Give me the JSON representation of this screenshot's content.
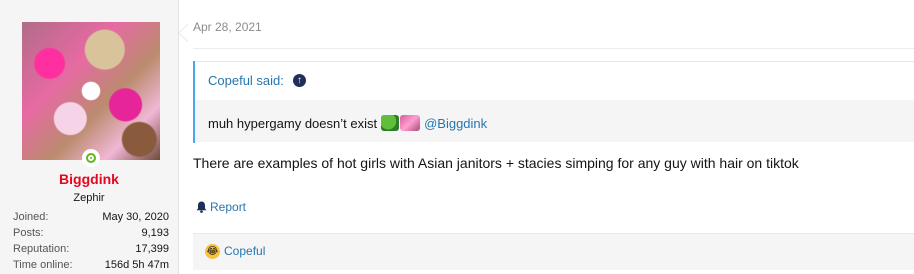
{
  "user": {
    "name": "Biggdink",
    "title": "Zephir",
    "stats": [
      {
        "label": "Joined:",
        "value": "May 30, 2020"
      },
      {
        "label": "Posts:",
        "value": "9,193"
      },
      {
        "label": "Reputation:",
        "value": "17,399"
      },
      {
        "label": "Time online:",
        "value": "156d 5h 47m"
      }
    ]
  },
  "post": {
    "date": "Apr 28, 2021",
    "quote": {
      "author_label": "Copeful said:",
      "text": "muh hypergamy doesn’t exist",
      "mention": "@Biggdink"
    },
    "body": "There are examples of hot girls with Asian janitors + stacies simping for any guy with hair on tiktok",
    "report_label": "Report",
    "reaction_user": "Copeful"
  },
  "colors": {
    "username": "#e5071f",
    "link": "#2577b1",
    "quote_border": "#47a7eb",
    "online": "#63b51f"
  }
}
